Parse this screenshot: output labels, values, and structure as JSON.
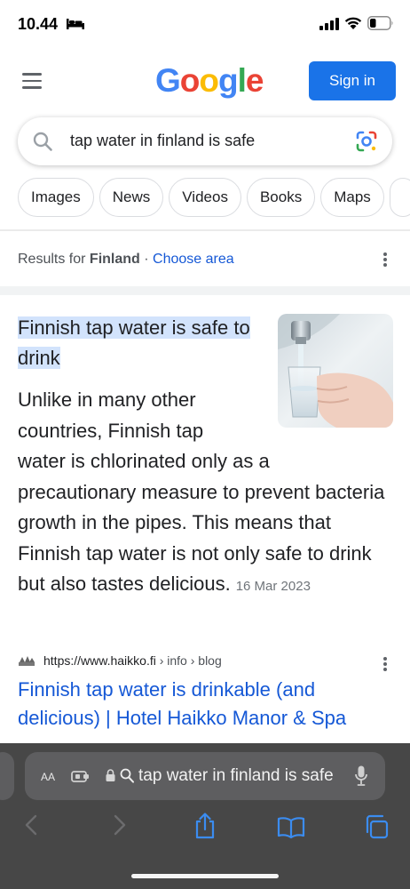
{
  "status": {
    "time": "10.44",
    "icons": [
      "bed-icon",
      "signal-icon",
      "wifi-icon",
      "battery-icon"
    ]
  },
  "header": {
    "logo_letters": [
      "G",
      "o",
      "o",
      "g",
      "l",
      "e"
    ],
    "signin_label": "Sign in",
    "colors": {
      "blue": "#4285f4",
      "red": "#ea4335",
      "yellow": "#fbbc05",
      "green": "#34a853",
      "button": "#1a73e8",
      "link": "#1558d6",
      "highlight": "#d2e3fc"
    }
  },
  "search": {
    "query": "tap water in finland is safe"
  },
  "chips": [
    "Images",
    "News",
    "Videos",
    "Books",
    "Maps"
  ],
  "location": {
    "prefix": "Results for",
    "place": "Finland",
    "separator": "·",
    "choose_area": "Choose area"
  },
  "snippet": {
    "title": "Finnish tap water is safe to drink",
    "body_lines": [
      "Unlike in many other",
      "countries, Finnish tap",
      "water is chlorinated only as a precautionary measure to prevent bacteria growth in the pipes. This means that Finnish tap water is not only safe to drink but also tastes delicious."
    ],
    "date": "16 Mar 2023",
    "image_icon": "water-glass-image"
  },
  "result": {
    "url": "https://www.haikko.fi",
    "crumbs": "› info › blog",
    "title": "Finnish tap water is drinkable (and delicious) | Hotel Haikko Manor & Spa"
  },
  "safari": {
    "aa_label": "AA",
    "address_text": "tap water in finland is safe",
    "toolbar_icons": [
      "back-icon",
      "forward-icon",
      "share-icon",
      "bookmarks-icon",
      "tabs-icon"
    ]
  }
}
